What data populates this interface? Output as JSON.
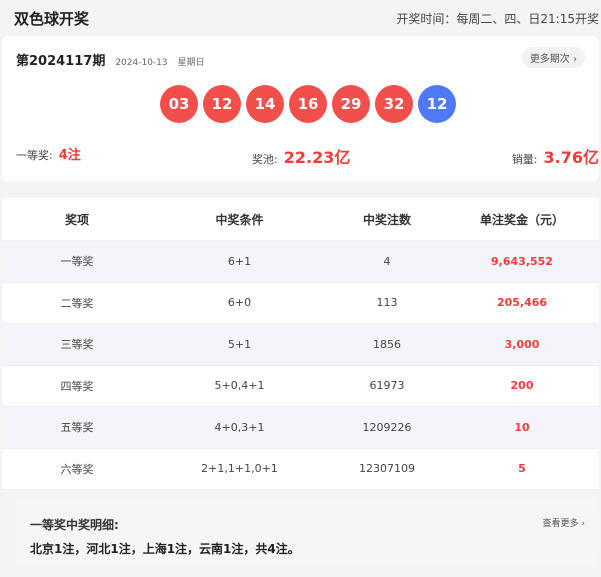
{
  "header": {
    "title": "双色球开奖",
    "schedule": "开奖时间：每周二、四、日21:15开奖"
  },
  "draw": {
    "issue": "第2024117期",
    "date": "2024-10-13",
    "weekday": "星期日",
    "more_label": "更多期次",
    "red_balls": [
      "03",
      "12",
      "14",
      "16",
      "29",
      "32"
    ],
    "blue_ball": "12",
    "colors": {
      "red": "#f04f4c",
      "blue": "#4f79f6",
      "accent": "#f03c3a"
    },
    "first_prize_label": "一等奖:",
    "first_prize_value": "4注",
    "pool_label": "奖池:",
    "pool_value": "22.23亿",
    "sales_label": "销量:",
    "sales_value": "3.76亿"
  },
  "table": {
    "headers": [
      "奖项",
      "中奖条件",
      "中奖注数",
      "单注奖金（元）"
    ],
    "rows": [
      {
        "level": "一等奖",
        "condition": "6+1",
        "count": "4",
        "prize": "9,643,552"
      },
      {
        "level": "二等奖",
        "condition": "6+0",
        "count": "113",
        "prize": "205,466"
      },
      {
        "level": "三等奖",
        "condition": "5+1",
        "count": "1856",
        "prize": "3,000"
      },
      {
        "level": "四等奖",
        "condition": "5+0,4+1",
        "count": "61973",
        "prize": "200"
      },
      {
        "level": "五等奖",
        "condition": "4+0,3+1",
        "count": "1209226",
        "prize": "10"
      },
      {
        "level": "六等奖",
        "condition": "2+1,1+1,0+1",
        "count": "12307109",
        "prize": "5"
      }
    ]
  },
  "detail": {
    "title": "一等奖中奖明细:",
    "more_label": "查看更多",
    "text": "北京1注，河北1注，上海1注，云南1注，共4注。"
  }
}
